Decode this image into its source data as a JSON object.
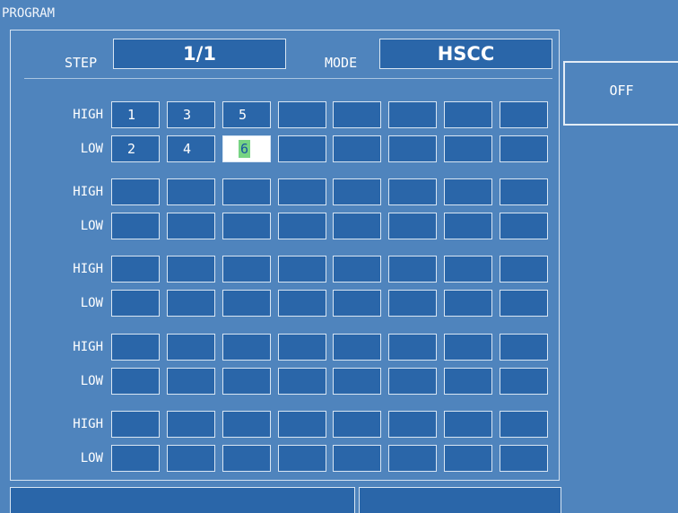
{
  "window": {
    "title": "PROGRAM"
  },
  "step": {
    "label": "STEP",
    "value": "1/1"
  },
  "mode": {
    "label": "MODE",
    "value": "HSCC"
  },
  "softkey": {
    "label": "OFF"
  },
  "grid": {
    "groups": [
      {
        "high_label": "HIGH",
        "low_label": "LOW",
        "high": [
          "1",
          "3",
          "5",
          "",
          "",
          "",
          "",
          ""
        ],
        "low": [
          "2",
          "4",
          "6",
          "",
          "",
          "",
          "",
          ""
        ]
      },
      {
        "high_label": "HIGH",
        "low_label": "LOW",
        "high": [
          "",
          "",
          "",
          "",
          "",
          "",
          "",
          ""
        ],
        "low": [
          "",
          "",
          "",
          "",
          "",
          "",
          "",
          ""
        ]
      },
      {
        "high_label": "HIGH",
        "low_label": "LOW",
        "high": [
          "",
          "",
          "",
          "",
          "",
          "",
          "",
          ""
        ],
        "low": [
          "",
          "",
          "",
          "",
          "",
          "",
          "",
          ""
        ]
      },
      {
        "high_label": "HIGH",
        "low_label": "LOW",
        "high": [
          "",
          "",
          "",
          "",
          "",
          "",
          "",
          ""
        ],
        "low": [
          "",
          "",
          "",
          "",
          "",
          "",
          "",
          ""
        ]
      },
      {
        "high_label": "HIGH",
        "low_label": "LOW",
        "high": [
          "",
          "",
          "",
          "",
          "",
          "",
          "",
          ""
        ],
        "low": [
          "",
          "",
          "",
          "",
          "",
          "",
          "",
          ""
        ]
      }
    ],
    "active_cell": {
      "group": 0,
      "row": "low",
      "col": 2
    }
  },
  "status": {
    "left": "",
    "right": ""
  },
  "colors": {
    "background": "#4f84bd",
    "field": "#2a66a9",
    "border": "#d9e6f3",
    "cursor": "#77d483"
  }
}
